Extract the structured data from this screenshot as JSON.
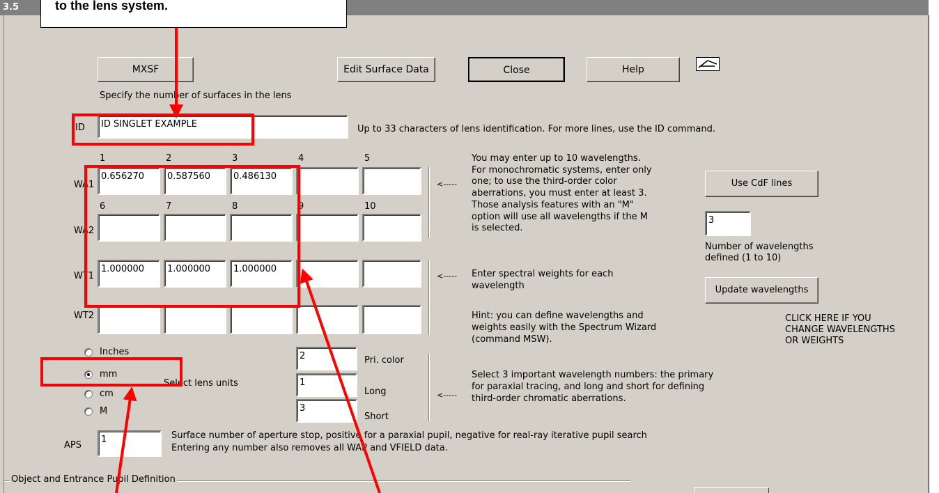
{
  "window": {
    "title": "3.5"
  },
  "callout": {
    "text": "to the lens system."
  },
  "buttons": {
    "mxsf": "MXSF",
    "edit_surface": "Edit Surface Data",
    "close": "Close",
    "help": "Help",
    "use_cdf": "Use CdF lines",
    "update_wavelengths": "Update wavelengths"
  },
  "texts": {
    "mxsf_hint": "Specify the number of surfaces in the lens",
    "id_label": "ID",
    "id_hint": "Up to 33 characters of lens identification.  For more lines, use the ID command.",
    "wa_info": [
      "You may enter up to 10 wavelengths.",
      "For monochromatic systems, enter only",
      "one; to use the third-order color",
      "aberrations, you must enter at least 3.",
      "Those analysis features with an \"M\"",
      "option will use all wavelengths if the M",
      "is selected."
    ],
    "wt_info": [
      "Enter spectral weights for each",
      "wavelength"
    ],
    "hint_info": [
      "Hint: you can define wavelengths and",
      "weights easily with the Spectrum Wizard",
      "(command MSW)."
    ],
    "select_info": [
      "Select 3 important wavelength numbers: the primary",
      "for paraxial tracing, and long and short for defining",
      "third-order chromatic aberrations."
    ],
    "arrow": "<-----",
    "num_wl_label": [
      "Number of wavelengths",
      "defined (1 to 10)"
    ],
    "click_here": [
      "CLICK HERE IF YOU",
      "CHANGE WAVELENGTHS",
      "OR WEIGHTS"
    ],
    "select_units": "Select lens units",
    "pri_color": "Pri. color",
    "long": "Long",
    "short": "Short",
    "aps_label": "APS",
    "aps_hint": [
      "Surface number of aperture stop, positive for a paraxial pupil, negative for real-ray iterative pupil search",
      "Entering any number also removes all WAP and VFIELD data."
    ],
    "group_label": "Object and Entrance Pupil Definition"
  },
  "fields": {
    "id_value": "ID SINGLET EXAMPLE",
    "num_wavelengths": "3",
    "pri_color": "2",
    "long": "1",
    "short": "3",
    "aps": "1"
  },
  "rows": {
    "wa1": {
      "label": "WA1",
      "cols": [
        "1",
        "2",
        "3",
        "4",
        "5"
      ],
      "values": [
        "0.656270",
        "0.587560",
        "0.486130",
        "",
        ""
      ]
    },
    "wa2": {
      "label": "WA2",
      "cols": [
        "6",
        "7",
        "8",
        "9",
        "10"
      ],
      "values": [
        "",
        "",
        "",
        "",
        ""
      ]
    },
    "wt1": {
      "label": "WT1",
      "values": [
        "1.000000",
        "1.000000",
        "1.000000",
        "",
        ""
      ]
    },
    "wt2": {
      "label": "WT2",
      "values": [
        "",
        "",
        "",
        "",
        ""
      ]
    }
  },
  "units": [
    "Inches",
    "mm",
    "cm",
    "M"
  ],
  "units_selected": "mm",
  "colors": {
    "annotation": "#ff0000",
    "dialog_bg": "#d4d0c8"
  }
}
